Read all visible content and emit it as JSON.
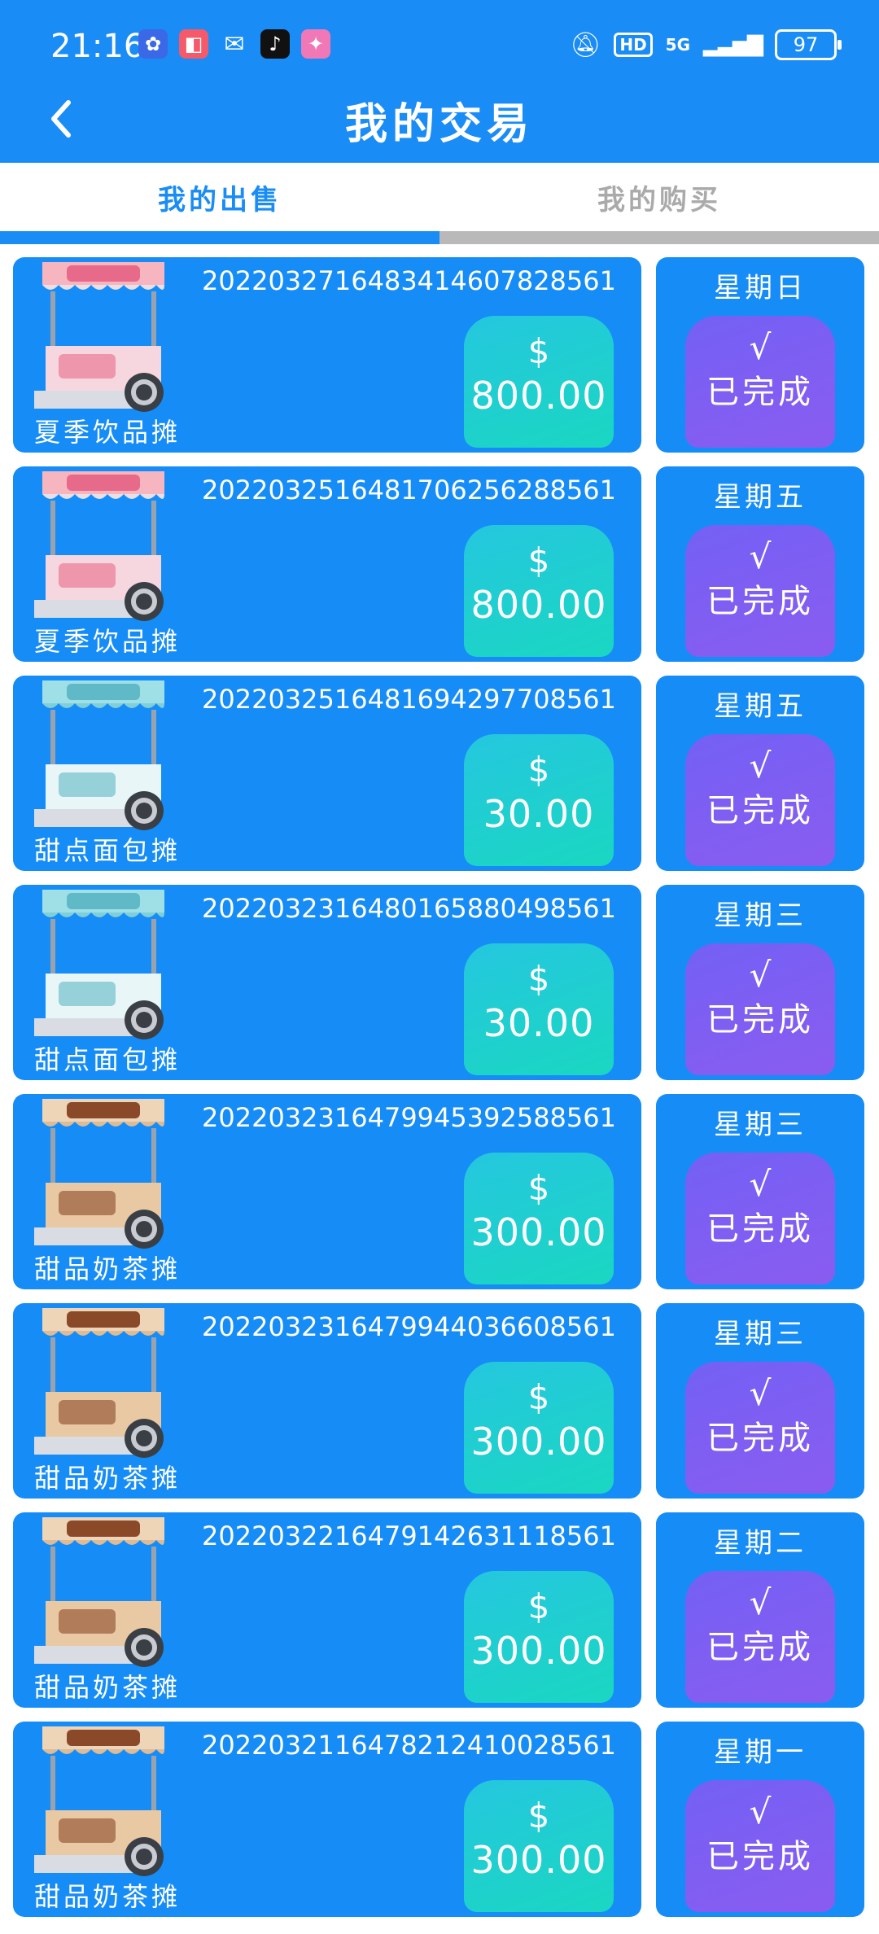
{
  "status_bar": {
    "time": "21:16",
    "hd": "HD",
    "network": "5G",
    "battery": "97"
  },
  "header": {
    "title": "我的交易"
  },
  "tabs": [
    {
      "label": "我的出售",
      "active": true
    },
    {
      "label": "我的购买",
      "active": false
    }
  ],
  "colors": {
    "primary": "#1a8cf5",
    "price_box": "#1dcfd0",
    "status_box": "#7c5cf3"
  },
  "orders": [
    {
      "stall": "夏季饮品摊",
      "stall_type": "summer-drink",
      "order_id": "20220327164834146078285​61",
      "currency": "$",
      "amount": "800.00",
      "weekday": "星期日",
      "check": "√",
      "status": "已完成"
    },
    {
      "stall": "夏季饮品摊",
      "stall_type": "summer-drink",
      "order_id": "2022032516481706256288561",
      "currency": "$",
      "amount": "800.00",
      "weekday": "星期五",
      "check": "√",
      "status": "已完成"
    },
    {
      "stall": "甜点面包摊",
      "stall_type": "dessert-bread",
      "order_id": "2022032516481694297708561",
      "currency": "$",
      "amount": "30.00",
      "weekday": "星期五",
      "check": "√",
      "status": "已完成"
    },
    {
      "stall": "甜点面包摊",
      "stall_type": "dessert-bread",
      "order_id": "2022032316480165880498561",
      "currency": "$",
      "amount": "30.00",
      "weekday": "星期三",
      "check": "√",
      "status": "已完成"
    },
    {
      "stall": "甜品奶茶摊",
      "stall_type": "milk-tea",
      "order_id": "2022032316479945392588561",
      "currency": "$",
      "amount": "300.00",
      "weekday": "星期三",
      "check": "√",
      "status": "已完成"
    },
    {
      "stall": "甜品奶茶摊",
      "stall_type": "milk-tea",
      "order_id": "2022032316479944036608561",
      "currency": "$",
      "amount": "300.00",
      "weekday": "星期三",
      "check": "√",
      "status": "已完成"
    },
    {
      "stall": "甜品奶茶摊",
      "stall_type": "milk-tea",
      "order_id": "2022032216479142631118561",
      "currency": "$",
      "amount": "300.00",
      "weekday": "星期二",
      "check": "√",
      "status": "已完成"
    },
    {
      "stall": "甜品奶茶摊",
      "stall_type": "milk-tea",
      "order_id": "2022032116478212410028561",
      "currency": "$",
      "amount": "300.00",
      "weekday": "星期一",
      "check": "√",
      "status": "已完成"
    }
  ]
}
